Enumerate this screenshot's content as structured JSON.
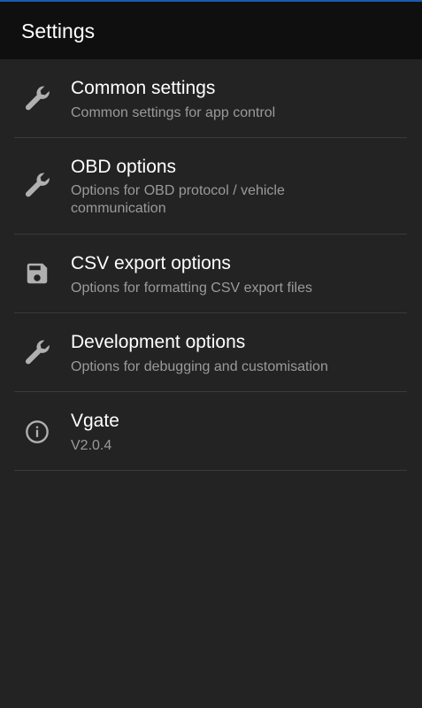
{
  "appbar": {
    "title": "Settings"
  },
  "items": [
    {
      "icon": "wrench-icon",
      "title": "Common settings",
      "summary": "Common settings for app control"
    },
    {
      "icon": "wrench-icon",
      "title": "OBD options",
      "summary": "Options for OBD protocol / vehicle communication"
    },
    {
      "icon": "save-icon",
      "title": "CSV export options",
      "summary": "Options for formatting CSV export files"
    },
    {
      "icon": "wrench-icon",
      "title": "Development options",
      "summary": "Options for debugging and customisation"
    },
    {
      "icon": "info-icon",
      "title": "Vgate",
      "summary": "V2.0.4"
    }
  ],
  "colors": {
    "background": "#232323",
    "appbar": "#0f0f0f",
    "accent_line": "#1e5aa8",
    "summary_text": "#9a9a9a"
  }
}
